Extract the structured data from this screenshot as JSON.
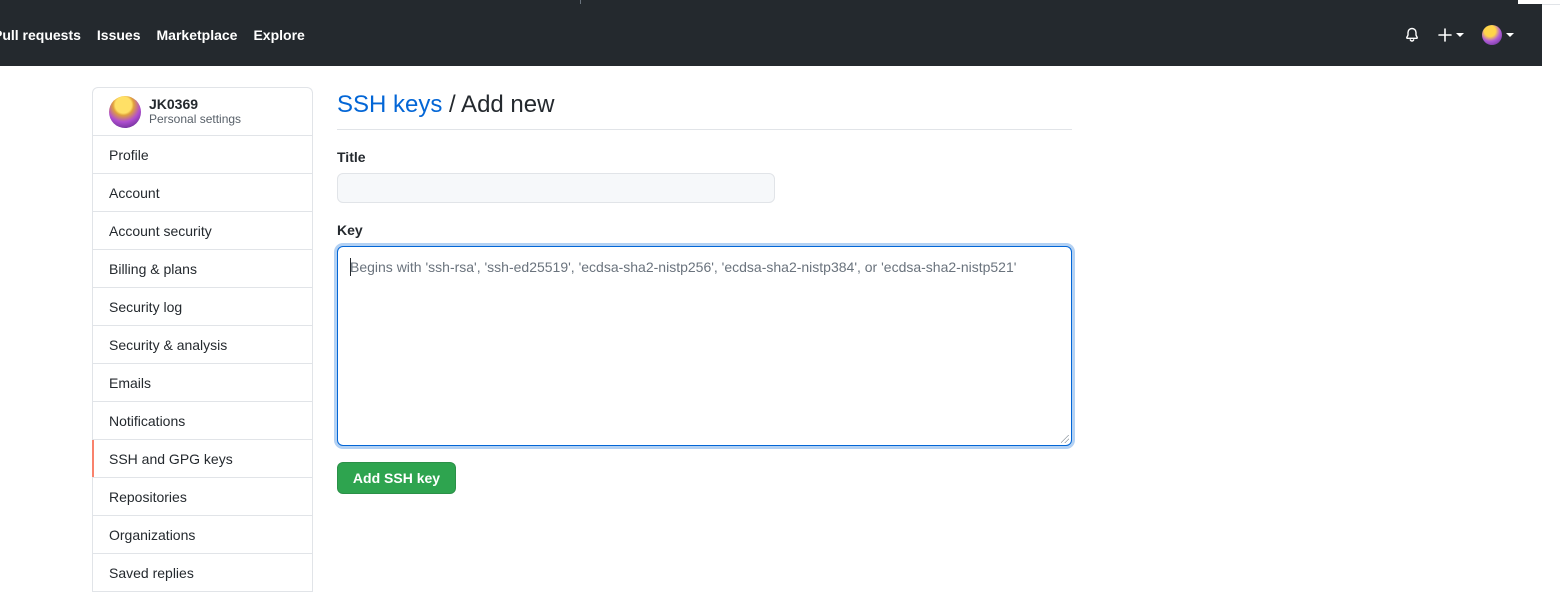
{
  "header": {
    "nav": [
      "Pull requests",
      "Issues",
      "Marketplace",
      "Explore"
    ],
    "icons": [
      "bell-icon",
      "plus-icon",
      "avatar"
    ],
    "bg_color": "#24292e"
  },
  "sidebar": {
    "username": "JK0369",
    "subtitle": "Personal settings",
    "items": [
      {
        "label": "Profile"
      },
      {
        "label": "Account"
      },
      {
        "label": "Account security"
      },
      {
        "label": "Billing & plans"
      },
      {
        "label": "Security log"
      },
      {
        "label": "Security & analysis"
      },
      {
        "label": "Emails"
      },
      {
        "label": "Notifications"
      },
      {
        "label": "SSH and GPG keys",
        "selected": true
      },
      {
        "label": "Repositories"
      },
      {
        "label": "Organizations"
      },
      {
        "label": "Saved replies"
      }
    ],
    "selected_accent": "#f9826c"
  },
  "main": {
    "breadcrumb_link": "SSH keys",
    "breadcrumb_rest": " / Add new",
    "title_label": "Title",
    "title_value": "",
    "key_label": "Key",
    "key_placeholder": "Begins with 'ssh-rsa', 'ssh-ed25519', 'ecdsa-sha2-nistp256', 'ecdsa-sha2-nistp384', or 'ecdsa-sha2-nistp521'",
    "submit_label": "Add SSH key",
    "link_color": "#0366d6",
    "button_color": "#2ea44f"
  }
}
